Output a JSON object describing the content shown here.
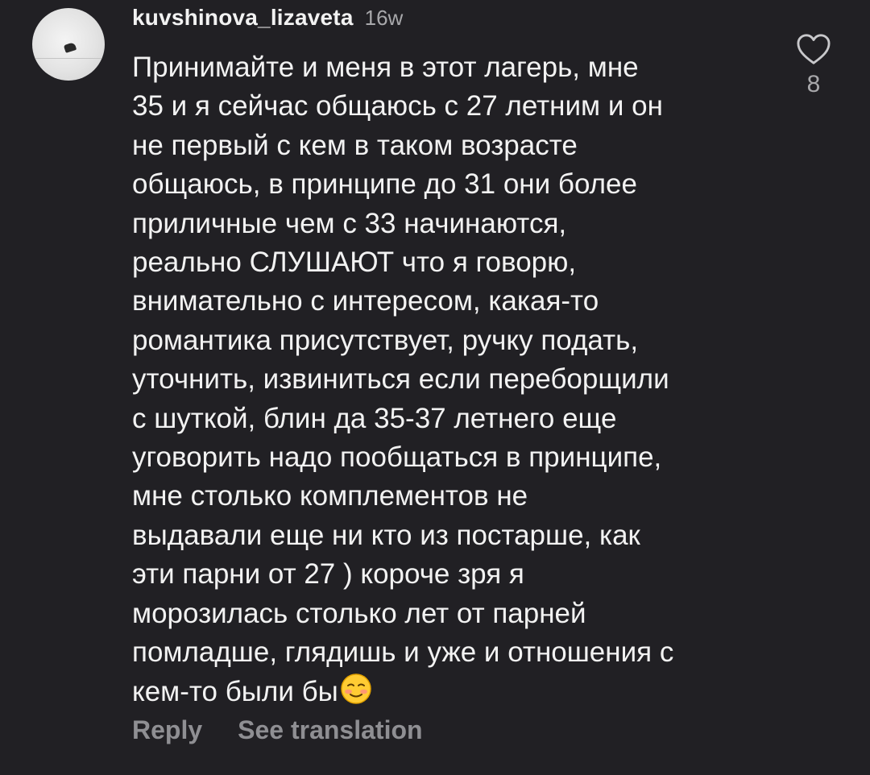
{
  "comment": {
    "username": "kuvshinova_lizaveta",
    "time": "16w",
    "text": "Принимайте и меня в этот лагерь, мне\n35 и я сейчас общаюсь с 27 летним и он\nне первый с кем в таком возрасте\nобщаюсь, в принципе до 31 они более\nприличные чем с 33 начинаются,\nреально СЛУШАЮТ что я говорю,\nвнимательно с интересом, какая-то\nромантика присутствует, ручку подать,\nуточнить, извиниться если переборщили\nс шуткой, блин да 35-37 летнего еще\nуговорить надо пообщаться в принципе,\nмне столько комплементов не\nвыдавали еще ни кто из постарше, как\nэти парни от 27 ) короче зря я\nморозилась столько лет от парней\nпомладше, глядишь и уже и отношения с\nкем-то были бы",
    "emoji": "smiling-face-with-blush-emoji",
    "like_icon": "heart-outline-icon",
    "like_count": "8"
  },
  "actions": {
    "reply_label": "Reply",
    "translate_label": "See translation"
  },
  "colors": {
    "background": "#212024",
    "text": "#f2f2f2",
    "muted": "#a8a8ab",
    "action": "#8f8f93"
  }
}
